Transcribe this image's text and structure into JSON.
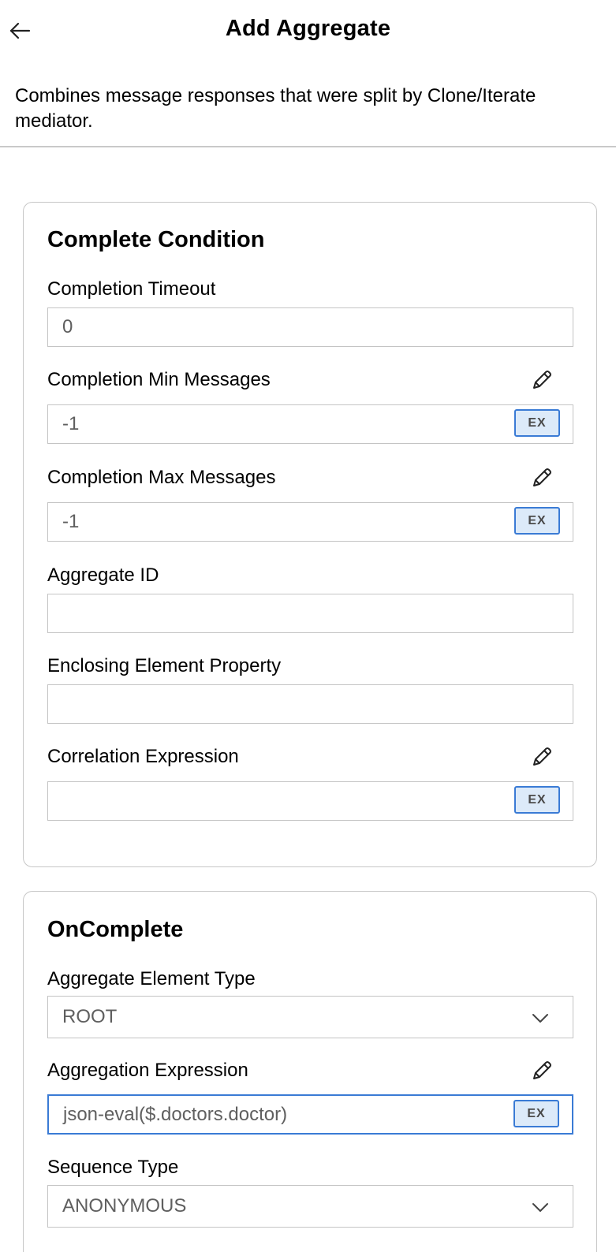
{
  "header": {
    "title": "Add Aggregate",
    "back_icon": "arrow-left-icon"
  },
  "description": "Combines message responses that were split by Clone/Iterate mediator.",
  "complete_condition": {
    "title": "Complete Condition",
    "completion_timeout": {
      "label": "Completion Timeout",
      "value": "0"
    },
    "completion_min_messages": {
      "label": "Completion Min Messages",
      "value": "-1",
      "ex_label": "EX"
    },
    "completion_max_messages": {
      "label": "Completion Max Messages",
      "value": "-1",
      "ex_label": "EX"
    },
    "aggregate_id": {
      "label": "Aggregate ID",
      "value": ""
    },
    "enclosing_element_property": {
      "label": "Enclosing Element Property",
      "value": ""
    },
    "correlation_expression": {
      "label": "Correlation Expression",
      "value": "",
      "ex_label": "EX"
    }
  },
  "on_complete": {
    "title": "OnComplete",
    "aggregate_element_type": {
      "label": "Aggregate Element Type",
      "value": "ROOT"
    },
    "aggregation_expression": {
      "label": "Aggregation Expression",
      "value": "json-eval($.doctors.doctor)",
      "ex_label": "EX"
    },
    "sequence_type": {
      "label": "Sequence Type",
      "value": "ANONYMOUS"
    }
  },
  "colors": {
    "accent": "#3a7bd5",
    "ex_background": "#dceaf9",
    "border": "#c4c4c4"
  }
}
